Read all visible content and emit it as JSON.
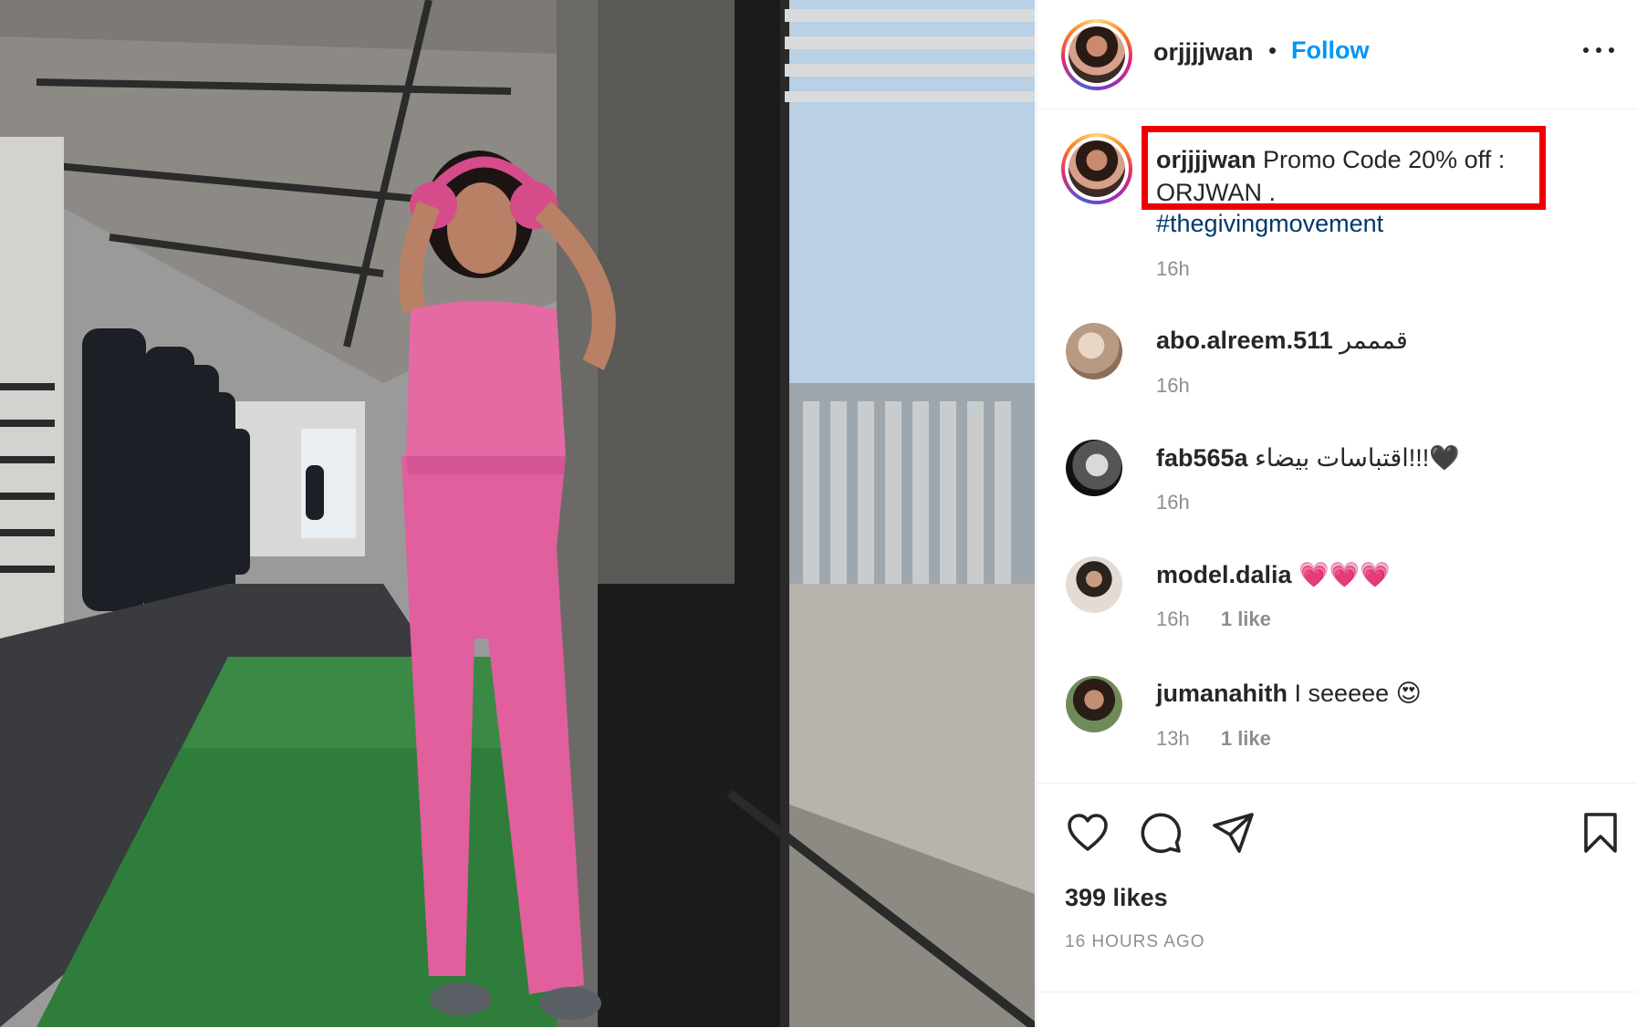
{
  "post": {
    "username": "orjjjjwan",
    "follow_label": "Follow",
    "separator": "•",
    "caption": {
      "username": "orjjjjwan",
      "text": "Promo Code 20% off : ORJWAN .",
      "hashtag": "#thegivingmovement",
      "time": "16h"
    },
    "comments": [
      {
        "username": "abo.alreem.511",
        "text": "قمممر",
        "time": "16h",
        "likes": ""
      },
      {
        "username": "fab565a",
        "text": "اقتباسات بيضاء!!!🖤",
        "time": "16h",
        "likes": ""
      },
      {
        "username": "model.dalia",
        "text": "💗💗💗",
        "time": "16h",
        "likes": "1 like"
      },
      {
        "username": "jumanahith",
        "text": "I seeeee 😍",
        "time": "13h",
        "likes": "1 like"
      }
    ],
    "likes_count": "399 likes",
    "posted_ago": "16 HOURS AGO"
  },
  "icons": {
    "more": "more-options-icon",
    "like": "heart-icon",
    "comment": "comment-icon",
    "share": "paper-plane-icon",
    "save": "bookmark-icon"
  },
  "colors": {
    "follow": "#0095f6",
    "highlight_box": "#ee0000",
    "hashtag": "#00376b",
    "secondary_text": "#8e8e8e"
  }
}
